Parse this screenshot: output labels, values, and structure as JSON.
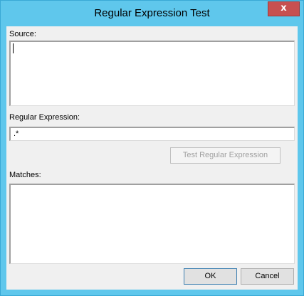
{
  "window": {
    "title": "Regular Expression Test",
    "close_glyph": "x"
  },
  "source": {
    "label": "Source:",
    "value": ""
  },
  "regex": {
    "label": "Regular Expression:",
    "value": ".*"
  },
  "test_button": {
    "label": "Test Regular Expression",
    "enabled": false
  },
  "matches": {
    "label": "Matches:",
    "value": ""
  },
  "buttons": {
    "ok_label": "OK",
    "cancel_label": "Cancel"
  },
  "colors": {
    "titlebar": "#5fc7ec",
    "close_button": "#c75050",
    "client_bg": "#f0f0f0"
  }
}
